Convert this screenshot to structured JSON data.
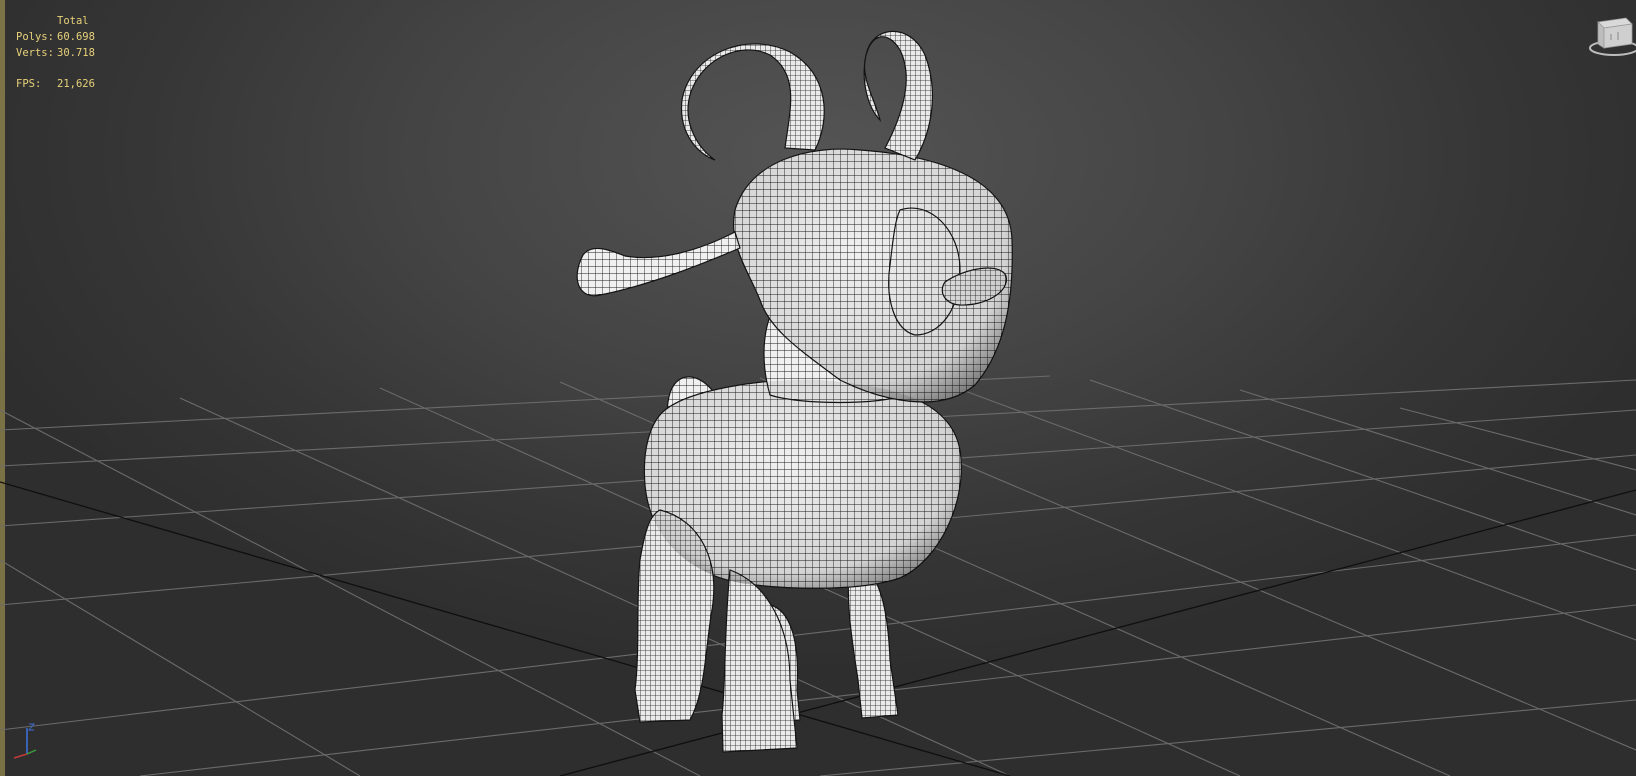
{
  "stats": {
    "header": "Total",
    "polys_label": "Polys:",
    "polys_value": "60.698",
    "verts_label": "Verts:",
    "verts_value": "30.718",
    "fps_label": "FPS:",
    "fps_value": "21,626"
  },
  "colors": {
    "stats_text": "#e8d27a",
    "grid_line": "#6a6a6a",
    "grid_axis": "#101010",
    "mesh_fill": "#f2f2f2",
    "mesh_wire": "#1a1a1a"
  },
  "icons": {
    "viewcube": "viewcube-icon",
    "axis_tripod": "axis-tripod-icon"
  }
}
